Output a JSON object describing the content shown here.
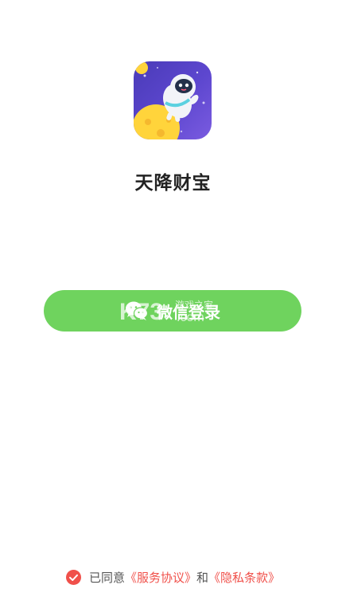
{
  "app": {
    "title": "天降财宝",
    "icon_name": "astronaut-moon-app-icon"
  },
  "login": {
    "button_label": "微信登录",
    "icon": "wechat-icon",
    "color": "#6fd35e"
  },
  "watermark": {
    "brand": "K73",
    "domain": ".com",
    "tagline": "游戏之家"
  },
  "agreement": {
    "checked": true,
    "prefix": "已同意",
    "terms_link": "《服务协议》",
    "conjunction": "和",
    "privacy_link": "《隐私条款》",
    "link_color": "#f0504a",
    "check_color": "#f0504a"
  }
}
